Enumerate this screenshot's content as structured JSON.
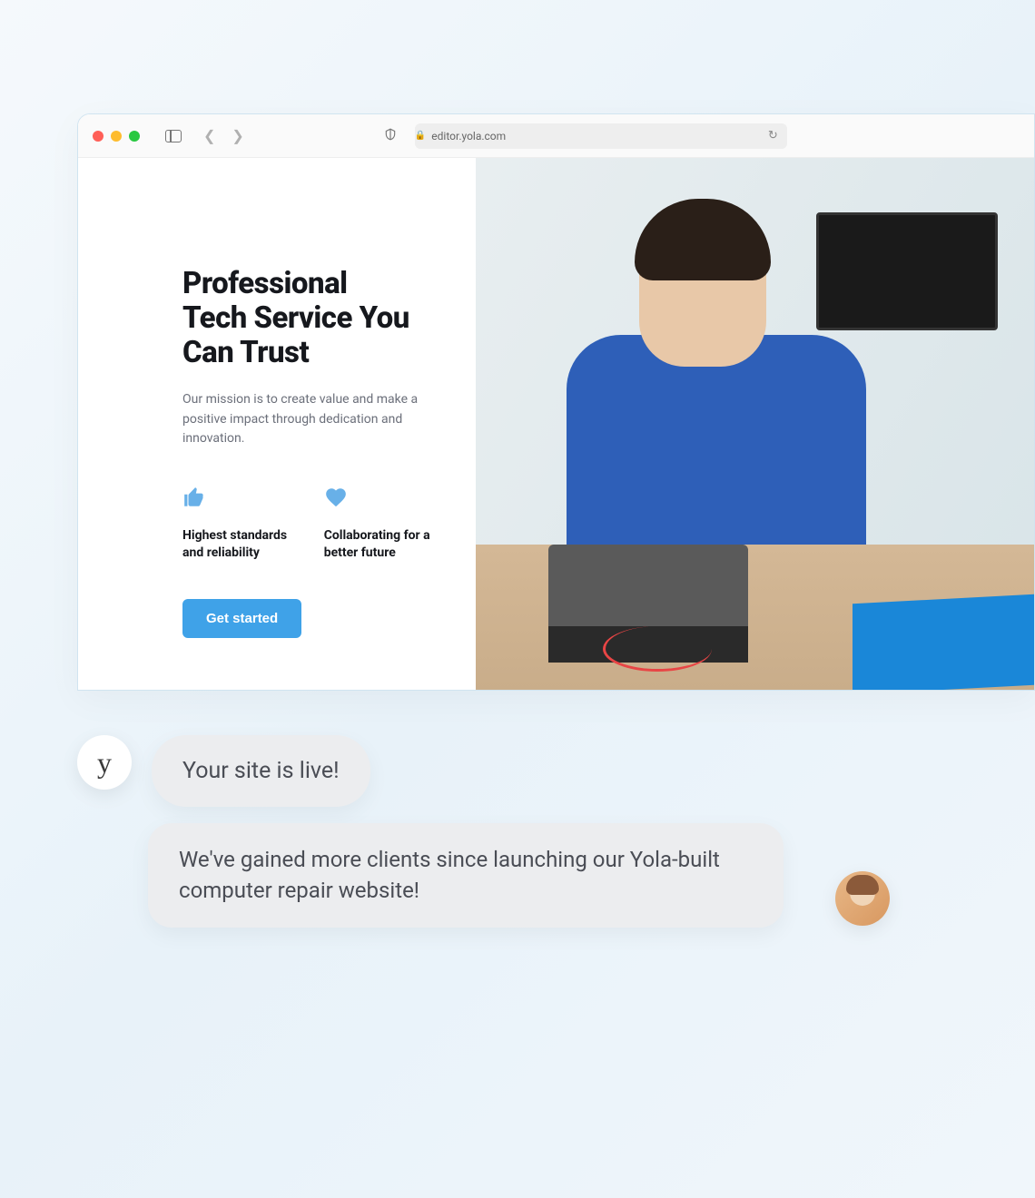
{
  "browser": {
    "url": "editor.yola.com"
  },
  "hero": {
    "title_line1": "Professional",
    "title_line2": "Tech Service You",
    "title_line3": "Can Trust",
    "subtitle": "Our mission is to create value and make a positive impact through dedication and innovation.",
    "features": [
      {
        "icon": "thumbs-up",
        "text": "Highest standards and reliability"
      },
      {
        "icon": "heart",
        "text": "Collaborating for a better future"
      }
    ],
    "cta_label": "Get started"
  },
  "chat": {
    "yola_avatar": "y",
    "msg1": "Your site is live!",
    "msg2": "We've gained more clients since launching our Yola-built computer repair website!"
  },
  "colors": {
    "accent": "#3fa2e8",
    "icon_blue": "#68b0e8"
  }
}
